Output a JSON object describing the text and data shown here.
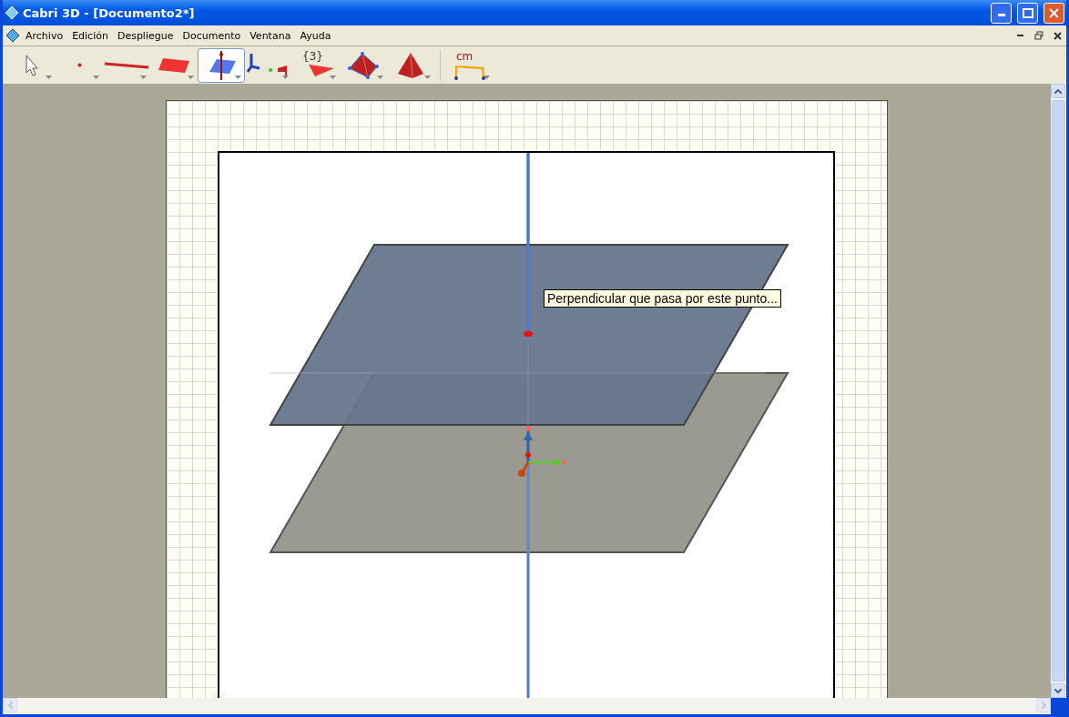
{
  "window": {
    "title": "Cabri 3D - [Documento2*]"
  },
  "menu": [
    "Archivo",
    "Edición",
    "Despliegue",
    "Documento",
    "Ventana",
    "Ayuda"
  ],
  "toolbar": [
    {
      "kind": "pointer",
      "selected": false
    },
    {
      "kind": "point",
      "selected": false
    },
    {
      "kind": "line",
      "selected": false
    },
    {
      "kind": "plane",
      "selected": false
    },
    {
      "kind": "perpendicular",
      "selected": true
    },
    {
      "kind": "transform",
      "selected": false
    },
    {
      "kind": "polygon",
      "label": "{3}",
      "selected": false
    },
    {
      "kind": "polyhedron",
      "selected": false
    },
    {
      "kind": "pyramid",
      "selected": false
    },
    {
      "kind": "measure",
      "label": "cm",
      "selected": false
    }
  ],
  "tooltip": "Perpendicular que pasa por este punto..."
}
